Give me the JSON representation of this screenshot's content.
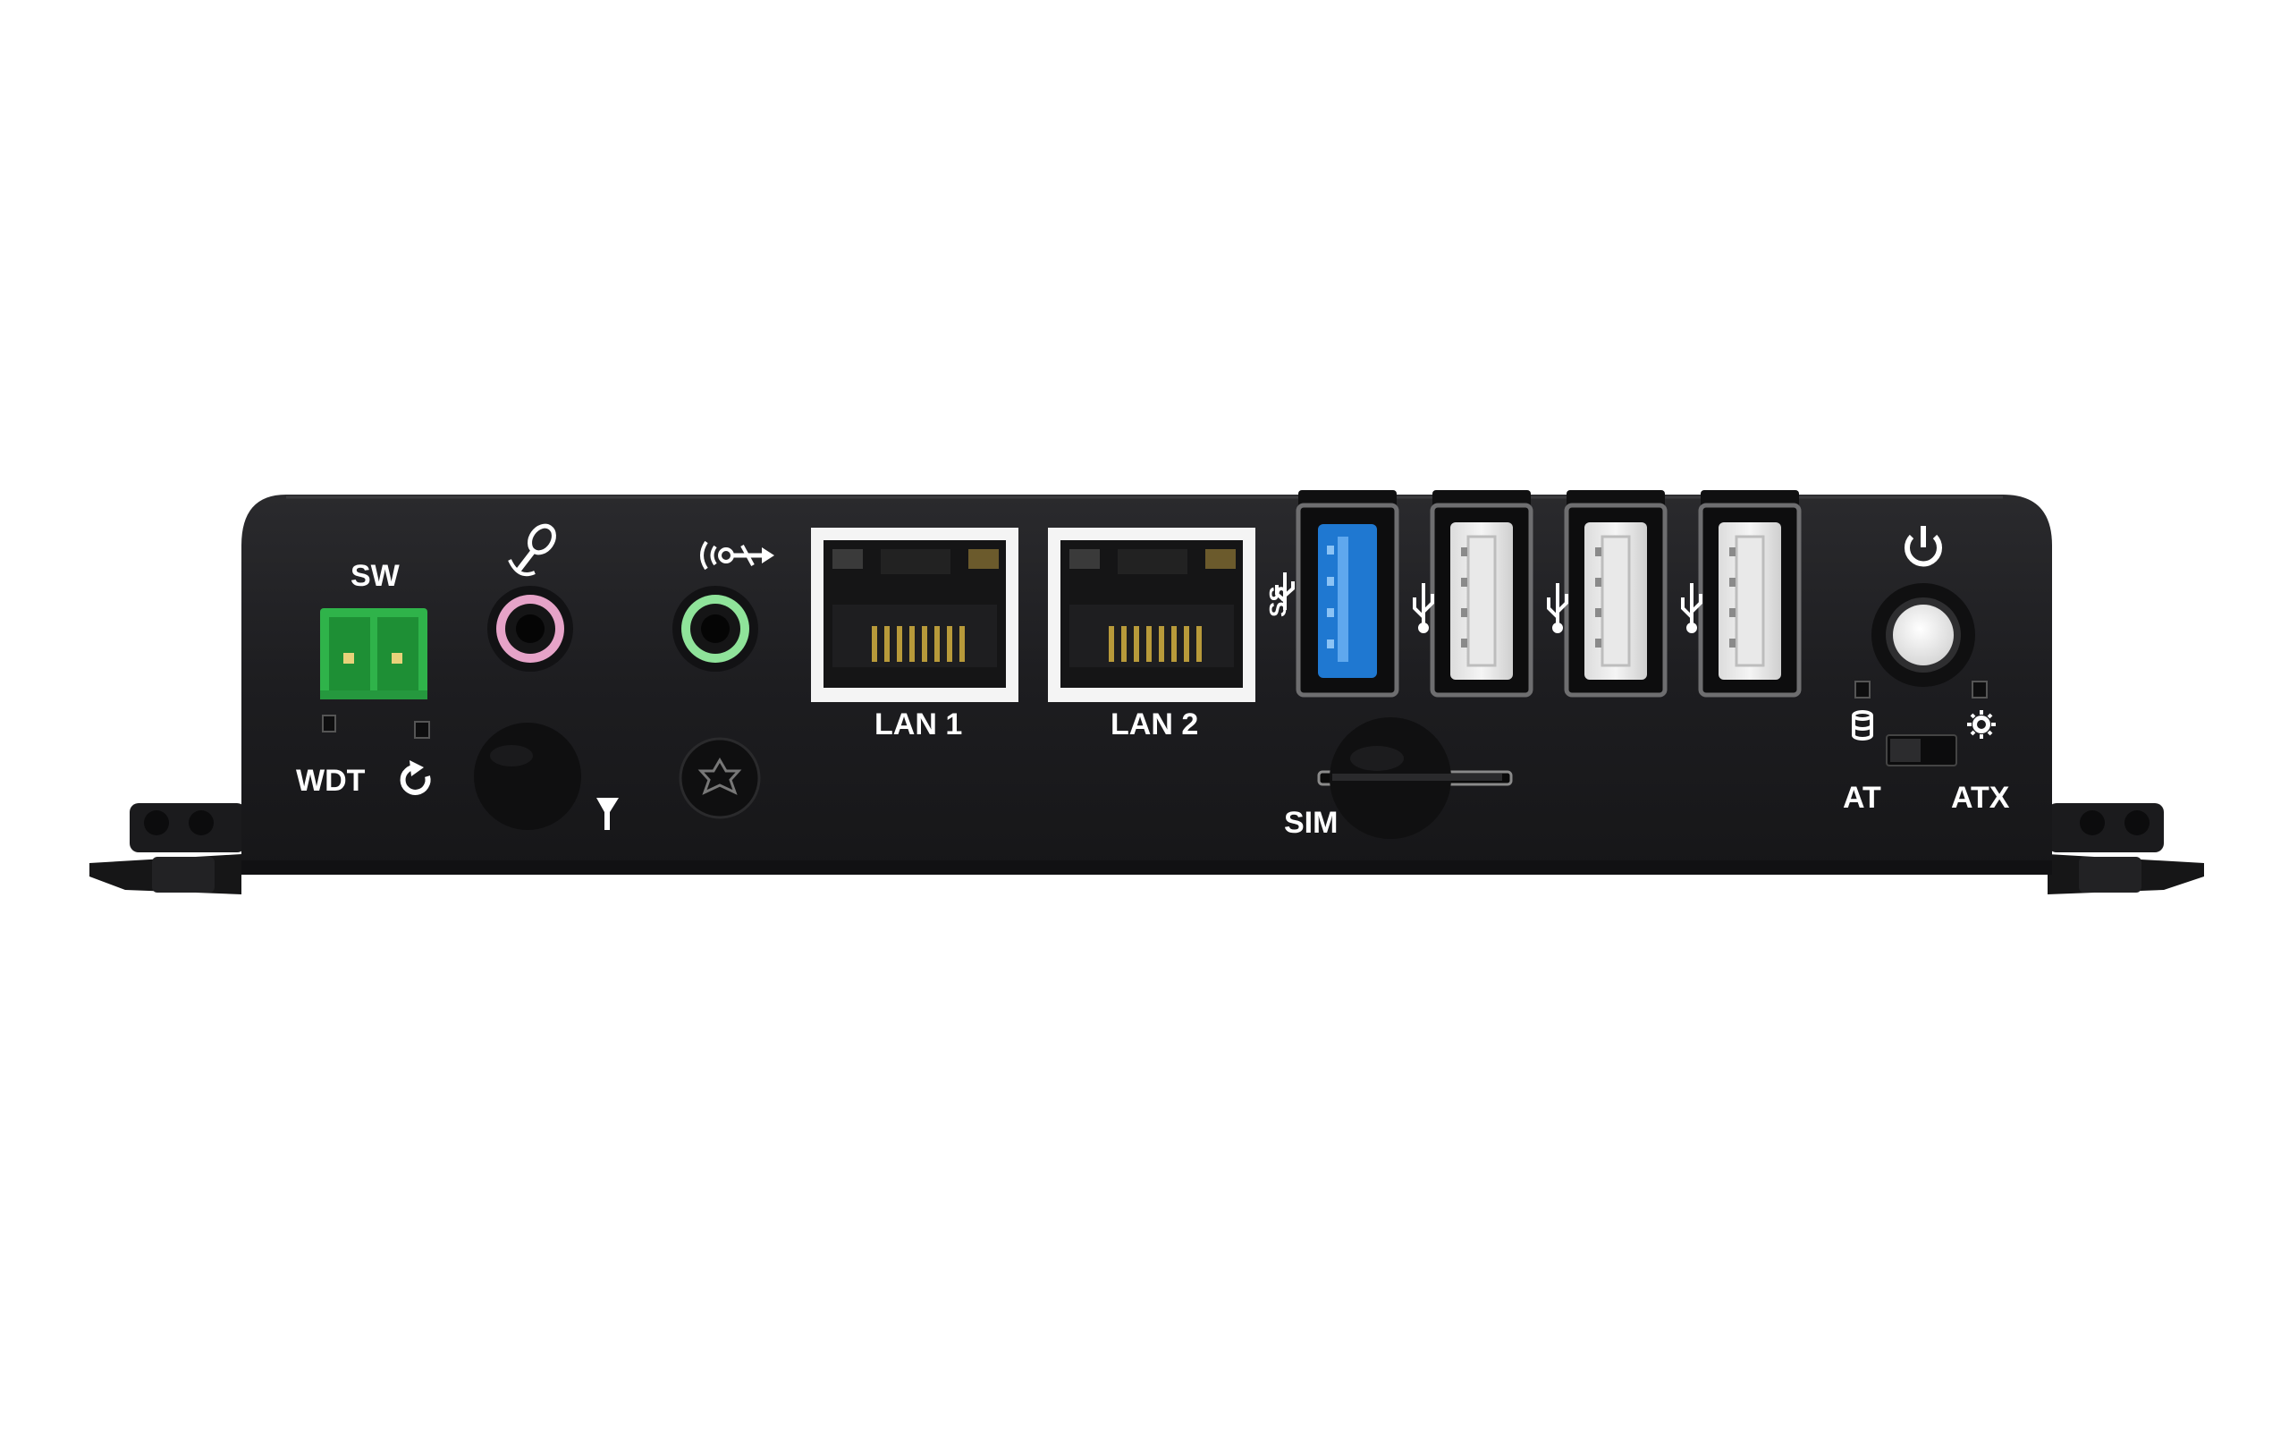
{
  "device": {
    "body_color": "#1c1c1e",
    "accent_green": "#2fb34a",
    "usb3_blue": "#1f78d1",
    "mic_ring_color": "#e6a3c8",
    "line_out_ring_color": "#8fe39a"
  },
  "labels": {
    "sw": "SW",
    "wdt": "WDT",
    "lan1": "LAN 1",
    "lan2": "LAN 2",
    "sim": "SIM",
    "at": "AT",
    "atx": "ATX",
    "ss": "SS"
  },
  "icons": {
    "microphone": "microphone-icon",
    "line_out": "line-out-icon",
    "antenna": "antenna-icon",
    "reset": "reset-icon",
    "usb": "usb-icon",
    "power": "power-icon",
    "storage_led": "storage-icon",
    "power_led": "power-led-icon"
  }
}
